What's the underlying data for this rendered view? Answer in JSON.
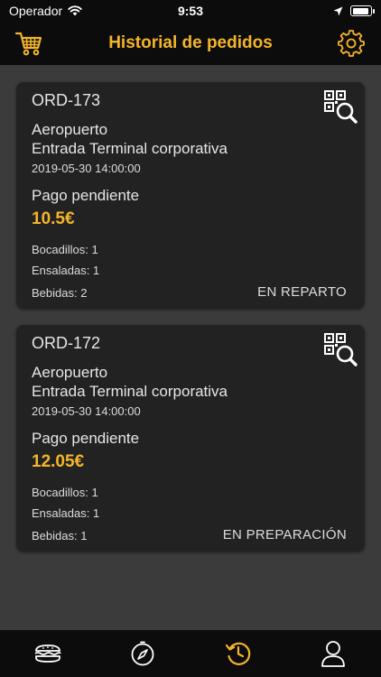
{
  "status_bar": {
    "carrier": "Operador",
    "time": "9:53",
    "battery_level": 0.95
  },
  "header": {
    "title": "Historial de pedidos",
    "icons": [
      "cart-icon",
      "gear-icon"
    ]
  },
  "colors": {
    "accent": "#f5b52a",
    "background": "#3b3b3b",
    "card": "#222222",
    "bar": "#0c0c0c"
  },
  "orders": [
    {
      "id": "ORD-173",
      "place": "Aeropuerto",
      "entry": "Entrada Terminal corporativa",
      "datetime": "2019-05-30 14:00:00",
      "payment": "Pago pendiente",
      "price": "10.5€",
      "items": [
        "Bocadillos: 1",
        "Ensaladas: 1",
        "Bebidas: 2"
      ],
      "status": "EN REPARTO"
    },
    {
      "id": "ORD-172",
      "place": "Aeropuerto",
      "entry": "Entrada Terminal corporativa",
      "datetime": "2019-05-30 14:00:00",
      "payment": "Pago pendiente",
      "price": "12.05€",
      "items": [
        "Bocadillos: 1",
        "Ensaladas: 1",
        "Bebidas: 1"
      ],
      "status": "EN PREPARACIÓN"
    }
  ],
  "tab_bar": {
    "tabs": [
      {
        "icon": "sandwich-icon",
        "active": false
      },
      {
        "icon": "compass-icon",
        "active": false
      },
      {
        "icon": "history-icon",
        "active": true
      },
      {
        "icon": "user-icon",
        "active": false
      }
    ]
  }
}
